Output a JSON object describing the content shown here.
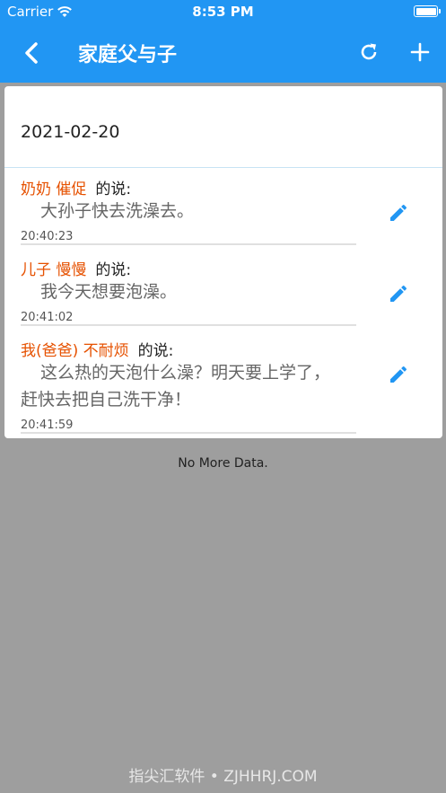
{
  "status_bar": {
    "carrier": "Carrier",
    "time": "8:53 PM"
  },
  "nav": {
    "title": "家庭父与子",
    "icons": [
      "chevron-left-icon",
      "refresh-icon",
      "plus-icon"
    ]
  },
  "card": {
    "date": "2021-02-20",
    "messages": [
      {
        "speaker": "奶奶 催促",
        "said": "的说:",
        "text": "大孙子快去洗澡去。",
        "time": "20:40:23"
      },
      {
        "speaker": "儿子 慢慢",
        "said": "的说:",
        "text": "我今天想要泡澡。",
        "time": "20:41:02"
      },
      {
        "speaker": "我(爸爸) 不耐烦",
        "said": "的说:",
        "text": "这么热的天泡什么澡？明天要上学了，赶快去把自己洗干净！",
        "time": "20:41:59"
      }
    ]
  },
  "footer": {
    "no_more": "No More Data."
  },
  "watermark": "指尖汇软件 • ZJHHRJ.COM",
  "colors": {
    "primary": "#2196f3",
    "speaker": "#e65100",
    "background": "#9e9e9e"
  }
}
